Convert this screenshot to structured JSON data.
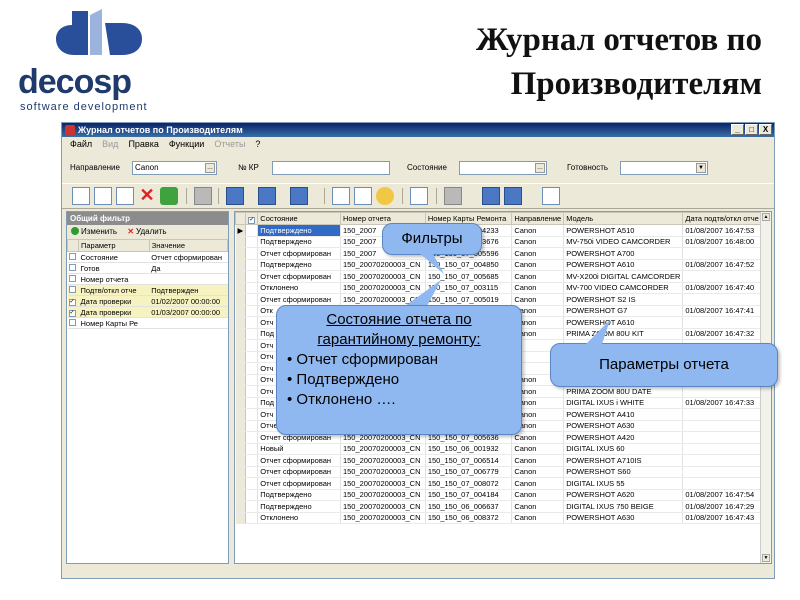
{
  "slide": {
    "title_line1": "Журнал отчетов по",
    "title_line2": "Производителям",
    "logo_text": "decosp",
    "logo_sub": "software development",
    "brand_color": "#1f3a6d"
  },
  "window": {
    "title": "Журнал отчетов по Производителям",
    "buttons": [
      "_",
      "□",
      "X"
    ],
    "menu": [
      "Файл",
      "Вид",
      "Правка",
      "Функции",
      "Отчеты",
      "?"
    ],
    "filters": {
      "direction_label": "Направление",
      "direction_value": "Canon",
      "kr_label": "№ КР",
      "kr_value": "",
      "state_label": "Состояние",
      "state_value": "",
      "ready_label": "Готовность",
      "ready_value": ""
    }
  },
  "left_panel": {
    "title": "Общий фильтр",
    "edit_label": "Изменить",
    "delete_label": "Удалить",
    "col_param": "Параметр",
    "col_value": "Значение",
    "rows": [
      {
        "checked": "",
        "param": "Состояние",
        "value": "Отчет сформирован"
      },
      {
        "checked": "",
        "param": "Готов",
        "value": "Да"
      },
      {
        "checked": "",
        "param": "Номер отчета",
        "value": ""
      },
      {
        "checked": "",
        "param": "Подтв/откл отче",
        "value": "Подтвержден"
      },
      {
        "checked": "✓",
        "param": "Дата проверки",
        "value": "01/02/2007 00:00:00"
      },
      {
        "checked": "✓",
        "param": "Дата проверки",
        "value": "01/03/2007 00:00:00"
      },
      {
        "checked": "",
        "param": "Номер Карты Ре",
        "value": ""
      }
    ]
  },
  "grid": {
    "columns": [
      "Состояние",
      "Номер отчета",
      "Номер Карты Ремонта",
      "Направление",
      "Модель",
      "Дата подтв/откл отче"
    ],
    "rows": [
      [
        "Подтверждено",
        "150_2007",
        "150_150_07_004233",
        "Canon",
        "POWERSHOT A510",
        "01/08/2007 16:47:53"
      ],
      [
        "Подтверждено",
        "150_2007",
        "150_150_07_003676",
        "Canon",
        "MV-750i VIDEO CAMCORDER",
        "01/08/2007 16:48:00"
      ],
      [
        "Отчет сформирован",
        "150_2007",
        "150_150_07_005596",
        "Canon",
        "POWERSHOT A700",
        ""
      ],
      [
        "Подтверждено",
        "150_20070200003_CN",
        "150_150_07_004850",
        "Canon",
        "POWERSHOT A610",
        "01/08/2007 16:47:52"
      ],
      [
        "Отчет сформирован",
        "150_20070200003_CN",
        "150_150_07_005685",
        "Canon",
        "MV-X200i DIGITAL CAMCORDER",
        ""
      ],
      [
        "Отклонено",
        "150_20070200003_CN",
        "150_150_07_003115",
        "Canon",
        "MV-700 VIDEO CAMCORDER",
        "01/08/2007 16:47:40"
      ],
      [
        "Отчет сформирован",
        "150_20070200003_CN",
        "150_150_07_005019",
        "Canon",
        "POWERSHOT S2 IS",
        ""
      ],
      [
        "Отк",
        "",
        "",
        "Canon",
        "POWERSHOT G7",
        "01/08/2007 16:47:41"
      ],
      [
        "Отч",
        "",
        "",
        "Canon",
        "POWERSHOT A610",
        ""
      ],
      [
        "Под",
        "",
        "",
        "Canon",
        "PRIMA ZOOM 80U KIT",
        "01/08/2007 16:47:32"
      ],
      [
        "Отч",
        "",
        "",
        "",
        "",
        ""
      ],
      [
        "Отч",
        "",
        "",
        "",
        "",
        ""
      ],
      [
        "Отч",
        "",
        "",
        "",
        "",
        ""
      ],
      [
        "Отч",
        "",
        "",
        "Canon",
        "POWERSHOT A530",
        ""
      ],
      [
        "Отч",
        "",
        "",
        "Canon",
        "PRIMA ZOOM 80U DATE",
        ""
      ],
      [
        "Под",
        "",
        "",
        "Canon",
        "DIGITAL IXUS i WHITE",
        "01/08/2007 16:47:33"
      ],
      [
        "Отч",
        "",
        "",
        "Canon",
        "POWERSHOT A410",
        ""
      ],
      [
        "Отчет сформирован",
        "150_20070200003_CN",
        "150_150_07_008634",
        "Canon",
        "POWERSHOT A630",
        ""
      ],
      [
        "Отчет сформирован",
        "150_20070200003_CN",
        "150_150_07_005636",
        "Canon",
        "POWERSHOT A420",
        ""
      ],
      [
        "Новый",
        "150_20070200003_CN",
        "150_150_06_001932",
        "Canon",
        "DIGITAL IXUS 60",
        ""
      ],
      [
        "Отчет сформирован",
        "150_20070200003_CN",
        "150_150_07_006514",
        "Canon",
        "POWERSHOT A710IS",
        ""
      ],
      [
        "Отчет сформирован",
        "150_20070200003_CN",
        "150_150_07_006779",
        "Canon",
        "POWERSHOT S60",
        ""
      ],
      [
        "Отчет сформирован",
        "150_20070200003_CN",
        "150_150_07_008072",
        "Canon",
        "DIGITAL IXUS 55",
        ""
      ],
      [
        "Подтверждено",
        "150_20070200003_CN",
        "150_150_07_004184",
        "Canon",
        "POWERSHOT A620",
        "01/08/2007 16:47:54"
      ],
      [
        "Подтверждено",
        "150_20070200003_CN",
        "150_150_06_006637",
        "Canon",
        "DIGITAL IXUS 750 BEIGE",
        "01/08/2007 16:47:29"
      ],
      [
        "Отклонено",
        "150_20070200003_CN",
        "150_150_06_008372",
        "Canon",
        "POWERSHOT A630",
        "01/08/2007 16:47:43"
      ]
    ]
  },
  "callouts": {
    "filters": "Фильтры",
    "params": "Параметры отчета",
    "state_title": "Состояние отчета по гарантийному ремонту:",
    "state_items": [
      "Отчет сформирован",
      "Подтверждено",
      "Отклонено …."
    ]
  }
}
